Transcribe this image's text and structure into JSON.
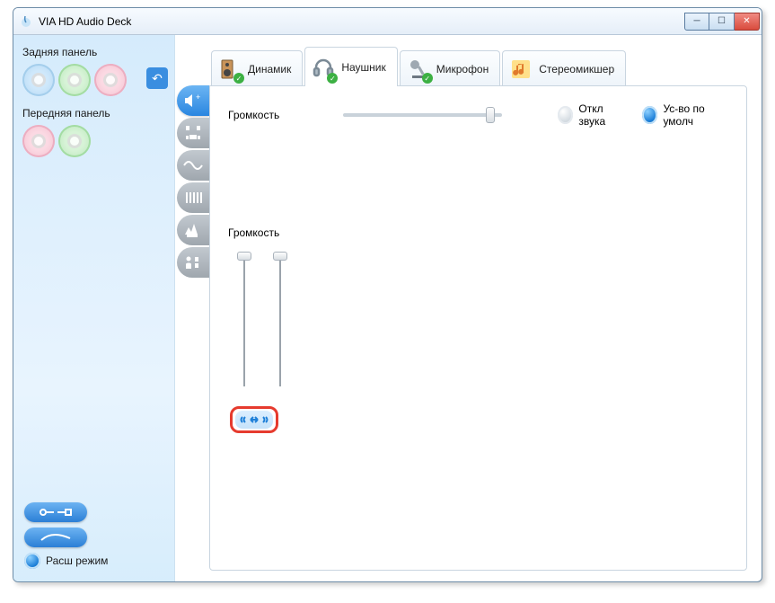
{
  "window": {
    "title": "VIA HD Audio Deck"
  },
  "left": {
    "rear_label": "Задняя панель",
    "front_label": "Передняя панель",
    "mode_label": "Расш режим"
  },
  "tabs": [
    {
      "label": "Динамик"
    },
    {
      "label": "Наушник"
    },
    {
      "label": "Микрофон"
    },
    {
      "label": "Стереомикшер"
    }
  ],
  "content": {
    "volume_label": "Громкость",
    "mute_label": "Откл звука",
    "default_label": "Ус-во по умолч",
    "volume2_label": "Громкость"
  },
  "icons": {
    "back": "↶",
    "min": "─",
    "max": "☐",
    "close": "✕",
    "check": "✓"
  }
}
